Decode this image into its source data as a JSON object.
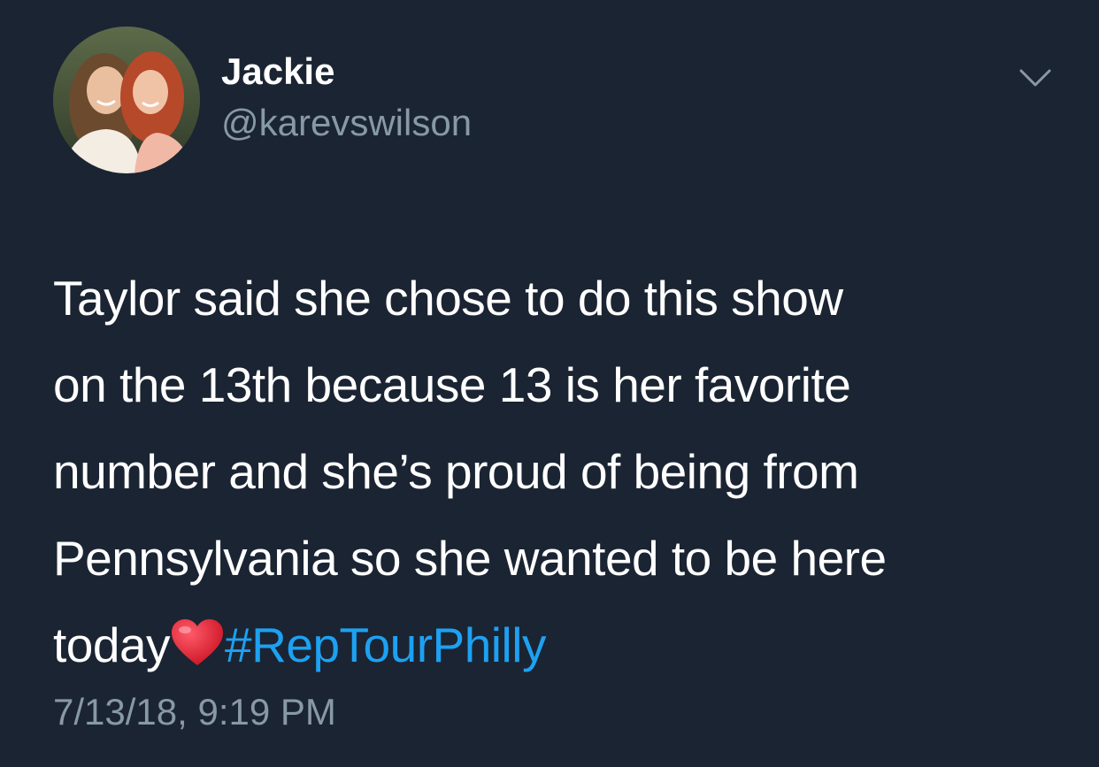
{
  "user": {
    "display_name": "Jackie",
    "handle": "@karevswilson",
    "avatar_icon": "profile-photo"
  },
  "menu": {
    "icon": "chevron-down-icon"
  },
  "tweet": {
    "lines": [
      "Taylor said she chose to do this show",
      "on the 13th because 13 is her favorite",
      "number and she’s proud of being from",
      "Pennsylvania so she wanted to be here"
    ],
    "last_line_text": "today",
    "emoji": "heart-emoji",
    "hashtag": "#RepTourPhilly",
    "timestamp": "7/13/18, 9:19 PM"
  },
  "colors": {
    "background": "#1b2432",
    "primary_text": "#ffffff",
    "secondary_text": "#8899a6",
    "link": "#1da1f2",
    "heart": "#e0182d"
  }
}
